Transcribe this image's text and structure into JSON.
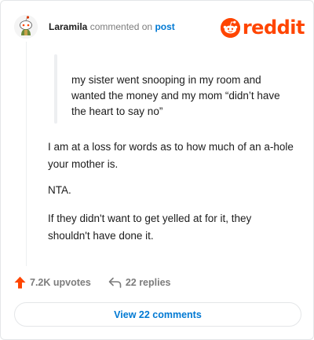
{
  "header": {
    "username": "Laramila",
    "action": "commented on",
    "post_link": "post",
    "brand": "reddit"
  },
  "comment": {
    "quote": "my sister went snooping in my room and wanted the money and my mom “didn’t have the heart to say no”",
    "paragraphs": [
      "I am at a loss for words as to how much of an a-hole your mother is.",
      "NTA.",
      "If they didn't want to get yelled at for it, they shouldn't have done it."
    ]
  },
  "footer": {
    "upvotes": "7.2K upvotes",
    "replies": "22 replies",
    "view_button": "View 22 comments"
  },
  "colors": {
    "brand": "#ff4500",
    "link": "#0079d3",
    "muted": "#7c7c7c"
  },
  "icons": {
    "avatar": "snoo-avatar-icon",
    "logo": "reddit-snoo-icon",
    "upvote": "upvote-arrow-icon",
    "reply": "reply-arrow-icon"
  }
}
